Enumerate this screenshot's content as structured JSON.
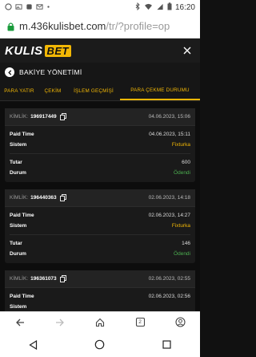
{
  "status_bar": {
    "time": "16:20",
    "left_icons": [
      "whatsapp-icon",
      "image-icon",
      "notification-icon",
      "mail-icon",
      "dot-icon"
    ],
    "right_icons": [
      "bluetooth-icon",
      "wifi-icon",
      "signal-icon",
      "battery-icon"
    ]
  },
  "browser": {
    "url_domain": "m.436kulisbet.com",
    "url_path": "/tr/?profile=op"
  },
  "site": {
    "logo_part1": "KULIS",
    "logo_part2": "BET"
  },
  "section": {
    "title": "BAKİYE YÖNETİMİ"
  },
  "tabs": [
    {
      "label": "PARA YATIR",
      "active": false
    },
    {
      "label": "ÇEKİM",
      "active": false
    },
    {
      "label": "İŞLEM GEÇMİŞİ",
      "active": false
    },
    {
      "label": "PARA ÇEKME DURUMU",
      "active": true
    }
  ],
  "records": [
    {
      "kimlik_label": "KİMLİK:",
      "id": "196917449",
      "date": "04.06.2023, 15:06",
      "paid_time_label": "Paid Time",
      "paid_time": "04.06.2023, 15:11",
      "sistem_label": "Sistem",
      "sistem": "Fixturka",
      "tutar_label": "Tutar",
      "tutar": "600",
      "durum_label": "Durum",
      "durum": "Ödendi"
    },
    {
      "kimlik_label": "KİMLİK:",
      "id": "196440363",
      "date": "02.06.2023, 14:18",
      "paid_time_label": "Paid Time",
      "paid_time": "02.06.2023, 14:27",
      "sistem_label": "Sistem",
      "sistem": "Fixturka",
      "tutar_label": "Tutar",
      "tutar": "146",
      "durum_label": "Durum",
      "durum": "Ödendi"
    },
    {
      "kimlik_label": "KİMLİK:",
      "id": "196361073",
      "date": "02.06.2023, 02:55",
      "paid_time_label": "Paid Time",
      "paid_time": "02.06.2023, 02:56",
      "sistem_label": "Sistem",
      "sistem": "",
      "tutar_label": "",
      "tutar": "",
      "durum_label": "",
      "durum": ""
    }
  ],
  "bottom_bar": {
    "tabs_count": "2"
  },
  "colors": {
    "accent": "#f2b705",
    "success": "#4caf50",
    "background": "#111111"
  }
}
